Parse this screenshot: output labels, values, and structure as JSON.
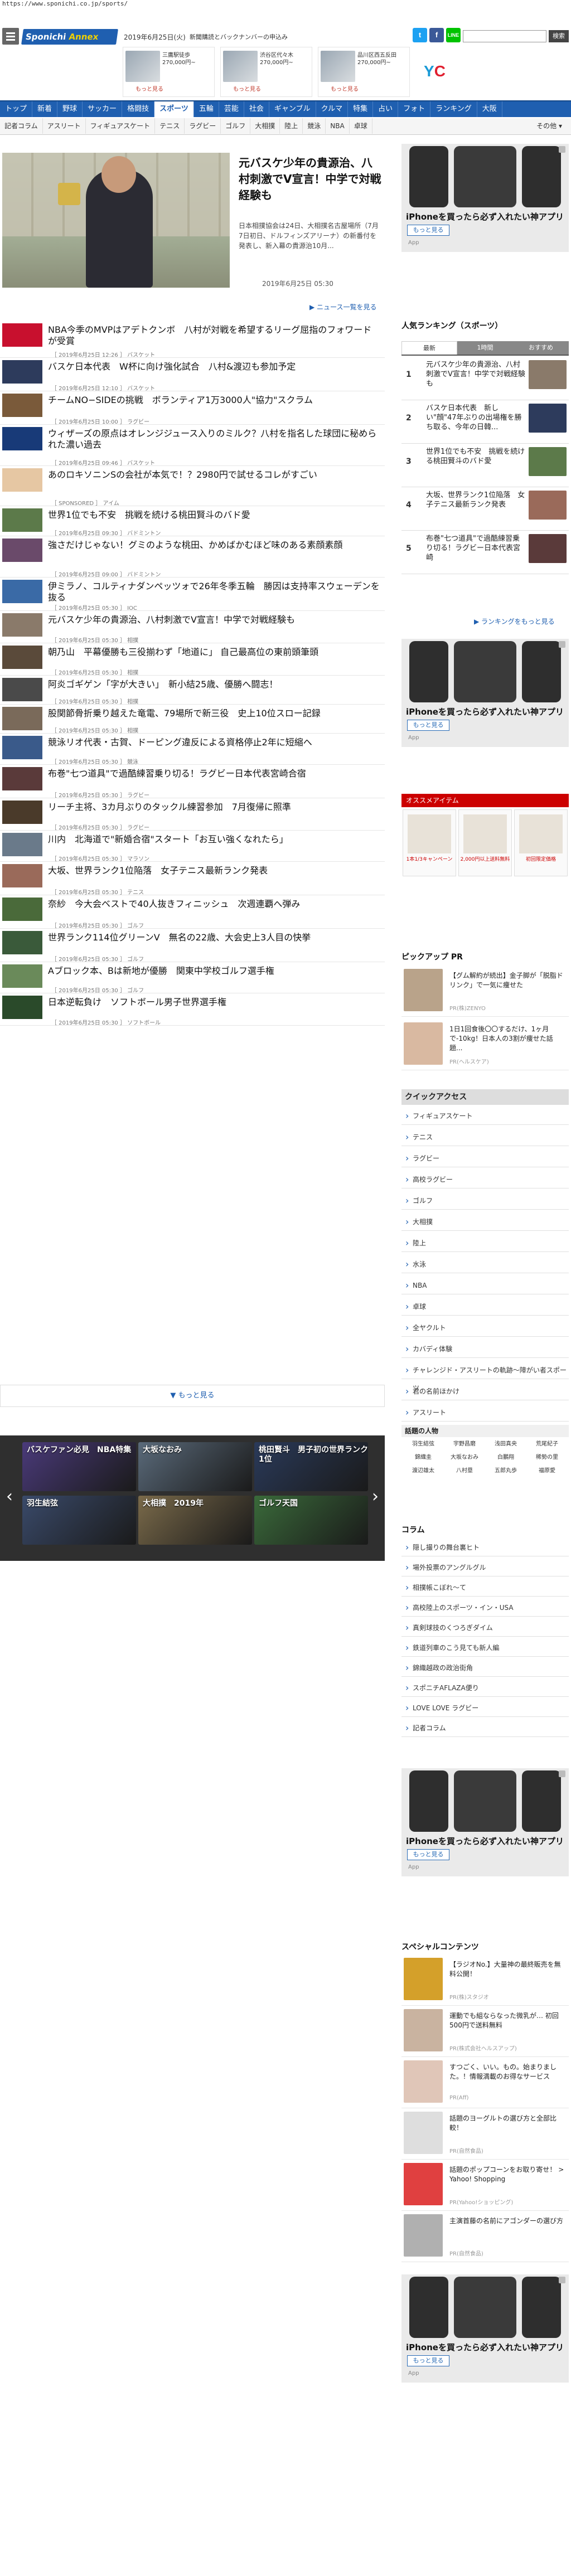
{
  "browser": {
    "url": "https://www.sponichi.co.jp/sports/"
  },
  "header": {
    "logo_main": "Sponichi",
    "logo_sub": "Annex",
    "date": "2019年6月25日(火)",
    "links": [
      "新聞購読とバックナンバーの申込み"
    ],
    "social": [
      {
        "label": "t",
        "color": "#1da1f2"
      },
      {
        "label": "f",
        "color": "#3b5998"
      },
      {
        "label": "LINE",
        "color": "#00c300"
      }
    ],
    "search_button": "検索"
  },
  "property_ads": [
    {
      "text": "三鷹駅徒歩 270,000円~",
      "more": "もっと見る"
    },
    {
      "text": "渋谷区代々木 270,000円~",
      "more": "もっと見る"
    },
    {
      "text": "品川区西五反田 270,000円~",
      "more": "もっと見る"
    }
  ],
  "nav": {
    "items": [
      "トップ",
      "新着",
      "野球",
      "サッカー",
      "格闘技",
      "スポーツ",
      "五輪",
      "芸能",
      "社会",
      "ギャンブル",
      "クルマ",
      "特集",
      "占い",
      "フォト",
      "ランキング",
      "大阪"
    ],
    "active": "スポーツ"
  },
  "subnav": {
    "items": [
      "記者コラム",
      "アスリート",
      "フィギュアスケート",
      "テニス",
      "ラグビー",
      "ゴルフ",
      "大相撲",
      "陸上",
      "競泳",
      "NBA",
      "卓球"
    ],
    "more": "その他 ▾"
  },
  "hero": {
    "title": "元バスケ少年の貴源治、八村刺激でV宣言！中学で対戦経験も",
    "body": "日本相撲協会は24日、大相撲名古屋場所（7月7日初日、ドルフィンズアリーナ）の新番付を発表し、新入幕の貴源治10月...",
    "date": "2019年6月25日 05:30",
    "more_link": "▶ ニュース一覧を見る"
  },
  "news": [
    {
      "title": "NBA今季のMVPはアデトクンボ　八村が対戦を希望するリーグ屈指のフォワードが受賞",
      "time": "［ 2019年6月25日 12:26 ］ バスケット"
    },
    {
      "title": "バスケ日本代表　W杯に向け強化試合　八村&渡辺も参加予定",
      "time": "［ 2019年6月25日 12:10 ］ バスケット"
    },
    {
      "title": "チームNO−SIDEの挑戦　ボランティア1万3000人\"協力\"スクラム",
      "time": "［ 2019年6月25日 10:00 ］ ラグビー"
    },
    {
      "title": "ウィザーズの原点はオレンジジュース入りのミルク？八村を指名した球団に秘められた濃い過去",
      "time": "［ 2019年6月25日 09:46 ］ バスケット"
    },
    {
      "title": "あのロキソニンSの会社が本気で！？2980円で試せるコレがすごい",
      "time": "［ SPONSORED ］ アイム"
    },
    {
      "title": "世界1位でも不安　挑戦を続ける桃田賢斗のバド愛",
      "time": "［ 2019年6月25日 09:30 ］ バドミントン"
    },
    {
      "title": "強さだけじゃない！グミのような桃田、かめばかむほど味のある素顔素顔",
      "time": "［ 2019年6月25日 09:00 ］ バドミントン"
    },
    {
      "title": "伊ミラノ、コルティナダンペッツォで26年冬季五輪　勝因は支持率スウェーデンを抜る",
      "time": "［ 2019年6月25日 05:30 ］ IOC"
    },
    {
      "title": "元バスケ少年の貴源治、八村刺激でV宣言！中学で対戦経験も",
      "time": "［ 2019年6月25日 05:30 ］ 相撲"
    },
    {
      "title": "朝乃山　平幕優勝も三役揃わず「地道に」 自己最高位の東前頭筆頭",
      "time": "［ 2019年6月25日 05:30 ］ 相撲"
    },
    {
      "title": "阿炎ゴギゲン「字が大きい」　新小結25歳、優勝へ闘志！",
      "time": "［ 2019年6月25日 05:30 ］ 相撲"
    },
    {
      "title": "股関節骨折乗り越えた竜電、79場所で新三役　史上10位スロー記録",
      "time": "［ 2019年6月25日 05:30 ］ 相撲"
    },
    {
      "title": "競泳リオ代表・古賀、ドーピング違反による資格停止2年に短縮へ",
      "time": "［ 2019年6月25日 05:30 ］ 競泳"
    },
    {
      "title": "布巻\"七つ道具\"で過酷練習乗り切る！ラグビー日本代表宮崎合宿",
      "time": "［ 2019年6月25日 05:30 ］ ラグビー"
    },
    {
      "title": "リーチ主将、3カ月ぶりのタックル練習参加　7月復帰に照準",
      "time": "［ 2019年6月25日 05:30 ］ ラグビー"
    },
    {
      "title": "川内　北海道で\"新婚合宿\"スタート「お互い強くなれたら」",
      "time": "［ 2019年6月25日 05:30 ］ マラソン"
    },
    {
      "title": "大坂、世界ランク1位陥落　女子テニス最新ランク発表",
      "time": "［ 2019年6月25日 05:30 ］ テニス"
    },
    {
      "title": "奈紗　今大会ベストで40人抜きフィニッシュ　次週連覇へ弾み",
      "time": "［ 2019年6月25日 05:30 ］ ゴルフ"
    },
    {
      "title": "世界ランク114位グリーンV　無名の22歳、大会史上3人目の快挙",
      "time": "［ 2019年6月25日 05:30 ］ ゴルフ"
    },
    {
      "title": "Aブロック本、Bは新地が優勝　関東中学校ゴルフ選手権",
      "time": "［ 2019年6月25日 05:30 ］ ゴルフ"
    },
    {
      "title": "日本逆転負け　ソフトボール男子世界選手権",
      "time": "［ 2019年6月25日 05:30 ］ ソフトボール"
    }
  ],
  "show_more": "▼ もっと見る",
  "carousel": [
    {
      "label": "バスケファン必見　NBA特集",
      "color": "#4a3a7a"
    },
    {
      "label": "大坂なおみ",
      "color": "#5a6a7a"
    },
    {
      "label": "桃田賢斗　男子初の世界ランク1位",
      "color": "#2a3a5a"
    },
    {
      "label": "羽生結弦",
      "color": "#3a4a6a"
    },
    {
      "label": "大相撲　2019年",
      "color": "#7a6a4a"
    },
    {
      "label": "ゴルフ天国",
      "color": "#3a6a3a"
    }
  ],
  "right": {
    "ad_caption": "iPhoneを買ったら必ず入れたい神アプリ",
    "ad_button": "もっと見る",
    "ad_sub": "App",
    "ranking_title": "人気ランキング（スポーツ）",
    "ranking_tabs": [
      "最新",
      "1時間",
      "おすすめ"
    ],
    "ranking": [
      {
        "n": "1",
        "t": "元バスケ少年の貴源治、八村刺激でV宣言！中学で対戦経験も"
      },
      {
        "n": "2",
        "t": "バスケ日本代表　新しい\"顔\"47年ぶりの出場権を勝ち取る、今年の日韓..."
      },
      {
        "n": "3",
        "t": "世界1位でも不安　挑戦を続ける桃田賢斗のバド愛"
      },
      {
        "n": "4",
        "t": "大坂、世界ランク1位陥落　女子テニス最新ランク発表"
      },
      {
        "n": "5",
        "t": "布巻\"七つ道具\"で過酷練習乗り切る！ラグビー日本代表宮崎"
      }
    ],
    "ranking_more": "▶ ランキングをもっと見る",
    "osusume": "オススメアイテム",
    "osusume_items": [
      "1本1/3キャンペーン",
      "2,000円以上送料無料",
      "初回限定価格"
    ],
    "pickup_title": "ピックアップ PR",
    "pickup": [
      {
        "t": "【グム解約が続出】金子脚が「脱脂ドリンク」で一気に痩せた",
        "pr": "PR(株)ZENYO"
      },
      {
        "t": "1日1回食後〇〇するだけ、1ヶ月で-10kg！日本人の3割が痩せた話題...",
        "pr": "PR(ヘルスケア)"
      }
    ],
    "quick_title": "クイックアクセス",
    "quick": [
      "フィギュアスケート",
      "テニス",
      "ラグビー",
      "高校ラグビー",
      "ゴルフ",
      "大相撲",
      "陸上",
      "水泳",
      "NBA",
      "卓球",
      "全ヤクルト",
      "カバディ体験",
      "チャレンジド・アスリートの軌跡～障がい者スポーツ",
      "君の名前ほかけ",
      "アスリート"
    ],
    "people_title": "話題の人物",
    "people": [
      "羽生結弦",
      "宇野昌磨",
      "浅田真央",
      "荒尾紀子",
      "錦織圭",
      "大坂なおみ",
      "白鵬翔",
      "稀勢の里",
      "渡辺雄太",
      "八村塁",
      "五郎丸歩",
      "福原愛"
    ],
    "column_title": "コラム",
    "columns": [
      "隠し撮りの舞台裏ヒト",
      "場外投票のアングルグル",
      "相撲帳こぼれ～て",
      "高校陸上のスポーツ・イン・USA",
      "真剣球技のくつろぎダイム",
      "鉄道列車のこう見ても新人編",
      "錦織越政の政治街角",
      "スポニチAFLAZA便り",
      "LOVE LOVE ラグビー",
      "記者コラム"
    ],
    "special_title": "スペシャルコンテンツ",
    "special": [
      {
        "t": "【ラジオNo.】大量神の最終販売を無料公開！",
        "pr": "PR(株)スタジオ"
      },
      {
        "t": "運動でも組ならなった微乳が… 初回500円で送料無料",
        "pr": "PR(株式会社ヘルスアップ)"
      },
      {
        "t": "すつごく、いい。もの。始まりました。！情報満載のお得なサービス",
        "pr": "PR(Aff)"
      },
      {
        "t": "話題のヨーグルトの選び方と全部比較！",
        "pr": "PR(自然食品)"
      },
      {
        "t": "話題のポップコーンをお取り寄せ！ > Yahoo! Shopping",
        "pr": "PR(Yahoo!ショッピング)"
      },
      {
        "t": "主演首藤の名前にアゴンダーの選び方",
        "pr": "PR(自然食品)"
      }
    ]
  }
}
